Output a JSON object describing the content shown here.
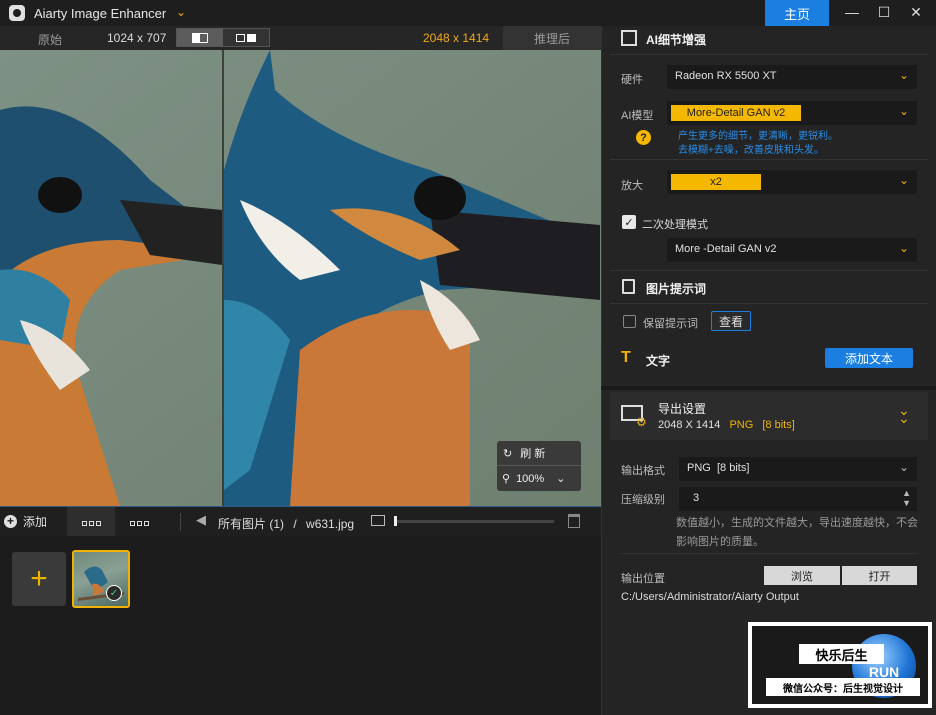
{
  "titlebar": {
    "app_title": "Aiarty Image Enhancer",
    "home_label": "主页"
  },
  "compare": {
    "original_label": "原始",
    "original_size": "1024 x 707",
    "output_size": "2048 x 1414",
    "after_label": "推理后"
  },
  "preview": {
    "refresh_label": "刷 新",
    "zoom_level": "100%"
  },
  "toolbar": {
    "add_label": "添加",
    "breadcrumb_all": "所有图片 (1)",
    "breadcrumb_sep": "/",
    "breadcrumb_file": "w631.jpg"
  },
  "ai_detail": {
    "title": "AI细节增强",
    "hardware_label": "硬件",
    "hardware_value": "Radeon RX 5500 XT",
    "model_label": "AI模型",
    "model_value": "More-Detail GAN v2",
    "model_hint_line1": "产生更多的细节，更清晰，更锐利。",
    "model_hint_line2": "去模糊+去噪，改善皮肤和头发。",
    "help_icon": "?",
    "scale_label": "放大",
    "scale_value": "x2",
    "second_pass_label": "二次处理模式",
    "second_pass_checked": true,
    "second_pass_model": "More -Detail GAN v2"
  },
  "prompt": {
    "title": "图片提示词",
    "keep_label": "保留提示词",
    "keep_checked": false,
    "view_button": "查看"
  },
  "text_section": {
    "title": "文字",
    "add_text_button": "添加文本"
  },
  "export": {
    "title": "导出设置",
    "size": "2048 X 1414",
    "format_short": "PNG",
    "bits_short": "[8 bits]",
    "format_label": "输出格式",
    "format_value": "PNG",
    "format_bits": "[8 bits]",
    "compression_label": "压缩级别",
    "compression_value": "3",
    "compression_hint_line1": "数值越小，生成的文件越大，导出速度越快，不会",
    "compression_hint_line2": "影响图片的质量。",
    "location_label": "输出位置",
    "browse_button": "浏览",
    "open_button": "打开",
    "path": "C:/Users/Administrator/Aiarty Output"
  },
  "watermark": {
    "top_text": "快乐后生",
    "bottom_text": "微信公众号：后生视觉设计",
    "logo_text": "RUN"
  },
  "colors": {
    "accent_yellow": "#f5b800",
    "accent_blue": "#1a7fe0",
    "hint_blue": "#2a8ce8",
    "output_size_orange": "#f0a818"
  }
}
